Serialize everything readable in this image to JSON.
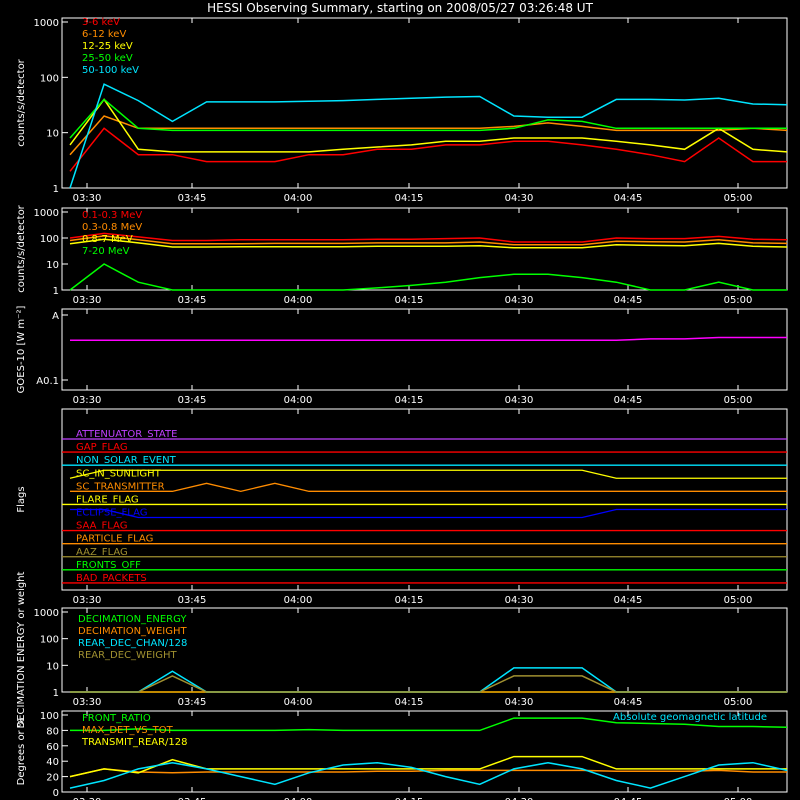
{
  "title": "HESSI Observing Summary, starting on 2008/05/27 03:26:48 UT",
  "colors": {
    "bg": "#000000",
    "axis": "#ffffff",
    "red": "#ff0000",
    "orange": "#ff8c00",
    "yellow": "#ffff00",
    "green": "#00ff00",
    "cyan": "#00e5ff",
    "magenta": "#ff00ff",
    "violet": "#c040ff",
    "blue": "#0000ff",
    "olive": "#a09030"
  },
  "time_ticks": [
    "03:30",
    "03:45",
    "04:00",
    "04:15",
    "04:30",
    "04:45",
    "05:00"
  ],
  "chart_data": [
    {
      "type": "line",
      "ylabel": "counts/s/detector",
      "yscale": "log",
      "ylim": [
        1,
        1000
      ],
      "yticks": [
        "1",
        "10",
        "100",
        "1000"
      ],
      "series": [
        {
          "name": "3-6 keV",
          "color": "#ff0000",
          "values": [
            2,
            12,
            4,
            4,
            3,
            3,
            3,
            4,
            4,
            5,
            5,
            6,
            6,
            7,
            7,
            6,
            5,
            4,
            3,
            8,
            3,
            3
          ]
        },
        {
          "name": "6-12 keV",
          "color": "#ff8c00",
          "values": [
            4,
            20,
            12,
            12,
            12,
            12,
            12,
            12,
            12,
            12,
            12,
            12,
            12,
            13,
            15,
            13,
            11,
            11,
            11,
            11,
            12,
            11
          ]
        },
        {
          "name": "12-25 keV",
          "color": "#ffff00",
          "values": [
            6,
            40,
            5,
            4.5,
            4.5,
            4.5,
            4.5,
            4.5,
            5,
            5.5,
            6,
            7,
            7,
            8,
            8,
            8,
            7,
            6,
            5,
            12,
            5,
            4.5
          ]
        },
        {
          "name": "25-50 keV",
          "color": "#00ff00",
          "values": [
            8,
            40,
            12,
            11,
            11,
            11,
            11,
            11,
            11,
            11,
            11,
            11,
            11,
            12,
            17,
            16,
            12,
            12,
            12,
            12,
            12,
            12
          ]
        },
        {
          "name": "50-100 keV",
          "color": "#00e5ff",
          "values": [
            1,
            75,
            38,
            16,
            36,
            36,
            36,
            37,
            38,
            40,
            42,
            44,
            45,
            20,
            19,
            19,
            40,
            40,
            39,
            42,
            33,
            32
          ]
        }
      ]
    },
    {
      "type": "line",
      "ylabel": "counts/s/detector",
      "yscale": "log",
      "ylim": [
        1,
        1000
      ],
      "yticks": [
        "1",
        "10",
        "100",
        "1000"
      ],
      "series": [
        {
          "name": "0.1-0.3 MeV",
          "color": "#ff0000",
          "values": [
            100,
            150,
            110,
            80,
            80,
            85,
            85,
            85,
            85,
            90,
            90,
            95,
            100,
            70,
            70,
            70,
            100,
            95,
            95,
            115,
            90,
            85
          ]
        },
        {
          "name": "0.3-0.8 MeV",
          "color": "#ff8c00",
          "values": [
            80,
            120,
            85,
            60,
            60,
            60,
            62,
            62,
            62,
            65,
            65,
            65,
            70,
            55,
            55,
            55,
            75,
            72,
            70,
            85,
            65,
            62
          ]
        },
        {
          "name": "0.8-7 MeV",
          "color": "#ffff00",
          "values": [
            60,
            90,
            65,
            45,
            45,
            46,
            46,
            46,
            46,
            48,
            48,
            48,
            50,
            42,
            42,
            42,
            55,
            52,
            50,
            62,
            48,
            45
          ]
        },
        {
          "name": "7-20 MeV",
          "color": "#00ff00",
          "values": [
            1,
            10,
            2,
            1,
            1,
            1,
            1,
            1,
            1,
            1.2,
            1.5,
            2,
            3,
            4,
            4,
            3,
            2,
            1,
            1,
            2,
            1,
            1
          ]
        }
      ]
    },
    {
      "type": "line",
      "ylabel": "GOES-10 [W m⁻²]",
      "yticks": [
        "A",
        "A0.1"
      ],
      "series": [
        {
          "name": "GOES",
          "color": "#ff00ff",
          "values": [
            0.7,
            0.7,
            0.7,
            0.7,
            0.7,
            0.7,
            0.7,
            0.7,
            0.7,
            0.7,
            0.7,
            0.7,
            0.7,
            0.7,
            0.7,
            0.7,
            0.7,
            0.72,
            0.72,
            0.74,
            0.74,
            0.74
          ]
        }
      ]
    },
    {
      "type": "line",
      "ylabel": "Flags",
      "series": [
        {
          "name": "ATTENUATOR_STATE",
          "color": "#c040ff",
          "values": [
            0
          ]
        },
        {
          "name": "GAP_FLAG",
          "color": "#ff0000",
          "values": [
            0
          ]
        },
        {
          "name": "NON_SOLAR_EVENT",
          "color": "#00e5ff",
          "values": [
            0
          ]
        },
        {
          "name": "SC_IN_SUNLIGHT",
          "color": "#ffff00",
          "values": [
            0,
            1,
            1,
            1,
            1,
            1,
            1,
            1,
            1,
            1,
            1,
            1,
            1,
            1,
            1,
            1,
            0,
            0,
            0,
            0,
            0,
            0
          ]
        },
        {
          "name": "SC_TRANSMITTER",
          "color": "#ff8c00",
          "values": [
            0,
            0,
            0,
            0,
            1,
            0,
            1,
            0,
            0,
            0,
            0,
            0,
            0,
            0,
            0,
            0,
            0,
            0,
            0,
            0,
            0,
            0
          ]
        },
        {
          "name": "FLARE_FLAG",
          "color": "#ffff00",
          "values": [
            0
          ]
        },
        {
          "name": "ECLIPSE_FLAG",
          "color": "#0000ff",
          "values": [
            1,
            1,
            0,
            0,
            0,
            0,
            0,
            0,
            0,
            0,
            0,
            0,
            0,
            0,
            0,
            0,
            1,
            1,
            1,
            1,
            1,
            1
          ]
        },
        {
          "name": "SAA_FLAG",
          "color": "#ff0000",
          "values": [
            0
          ]
        },
        {
          "name": "PARTICLE_FLAG",
          "color": "#ff8c00",
          "values": [
            0
          ]
        },
        {
          "name": "AAZ_FLAG",
          "color": "#a09030",
          "values": [
            0
          ]
        },
        {
          "name": "FRONTS_OFF",
          "color": "#00ff00",
          "values": [
            0
          ]
        },
        {
          "name": "BAD_PACKETS",
          "color": "#ff0000",
          "values": [
            0
          ]
        }
      ]
    },
    {
      "type": "line",
      "ylabel": "DECIMATION ENERGY or weight",
      "yscale": "log",
      "ylim": [
        1,
        1000
      ],
      "yticks": [
        "1",
        "10",
        "100",
        "1000"
      ],
      "series": [
        {
          "name": "DECIMATION_ENERGY",
          "color": "#00ff00",
          "values": [
            1
          ]
        },
        {
          "name": "DECIMATION_WEIGHT",
          "color": "#ff8c00",
          "values": [
            1
          ]
        },
        {
          "name": "REAR_DEC_CHAN/128",
          "color": "#00e5ff",
          "values": [
            1,
            1,
            1,
            6,
            1,
            1,
            1,
            1,
            1,
            1,
            1,
            1,
            1,
            8,
            8,
            8,
            1,
            1,
            1,
            1,
            1,
            1
          ]
        },
        {
          "name": "REAR_DEC_WEIGHT",
          "color": "#a09030",
          "values": [
            1,
            1,
            1,
            4,
            1,
            1,
            1,
            1,
            1,
            1,
            1,
            1,
            1,
            4,
            4,
            4,
            1,
            1,
            1,
            1,
            1,
            1
          ]
        }
      ]
    },
    {
      "type": "line",
      "ylabel": "Degrees or %",
      "ylim": [
        0,
        100
      ],
      "yticks": [
        "0",
        "20",
        "40",
        "60",
        "80",
        "100"
      ],
      "annotation": "Absolute geomagnetic latitude",
      "series": [
        {
          "name": "FRONT_RATIO",
          "color": "#00ff00",
          "values": [
            80,
            80,
            82,
            80,
            80,
            80,
            80,
            81,
            80,
            80,
            80,
            80,
            80,
            96,
            96,
            96,
            90,
            89,
            88,
            85,
            85,
            84
          ]
        },
        {
          "name": "MAX_DET_VS_TOT",
          "color": "#ff8c00",
          "values": [
            20,
            30,
            26,
            25,
            26,
            26,
            26,
            26,
            26,
            27,
            27,
            28,
            28,
            28,
            28,
            28,
            27,
            27,
            27,
            28,
            26,
            26
          ]
        },
        {
          "name": "TRANSMIT_REAR/128",
          "color": "#ffff00",
          "values": [
            20,
            30,
            25,
            42,
            30,
            30,
            30,
            30,
            30,
            30,
            30,
            30,
            30,
            46,
            46,
            46,
            30,
            30,
            30,
            30,
            30,
            30
          ]
        },
        {
          "name": "geomagnetic latitude",
          "color": "#00e5ff",
          "values": [
            5,
            15,
            30,
            38,
            30,
            20,
            10,
            25,
            35,
            38,
            32,
            20,
            10,
            30,
            38,
            30,
            15,
            5,
            20,
            35,
            38,
            28
          ]
        }
      ]
    }
  ]
}
